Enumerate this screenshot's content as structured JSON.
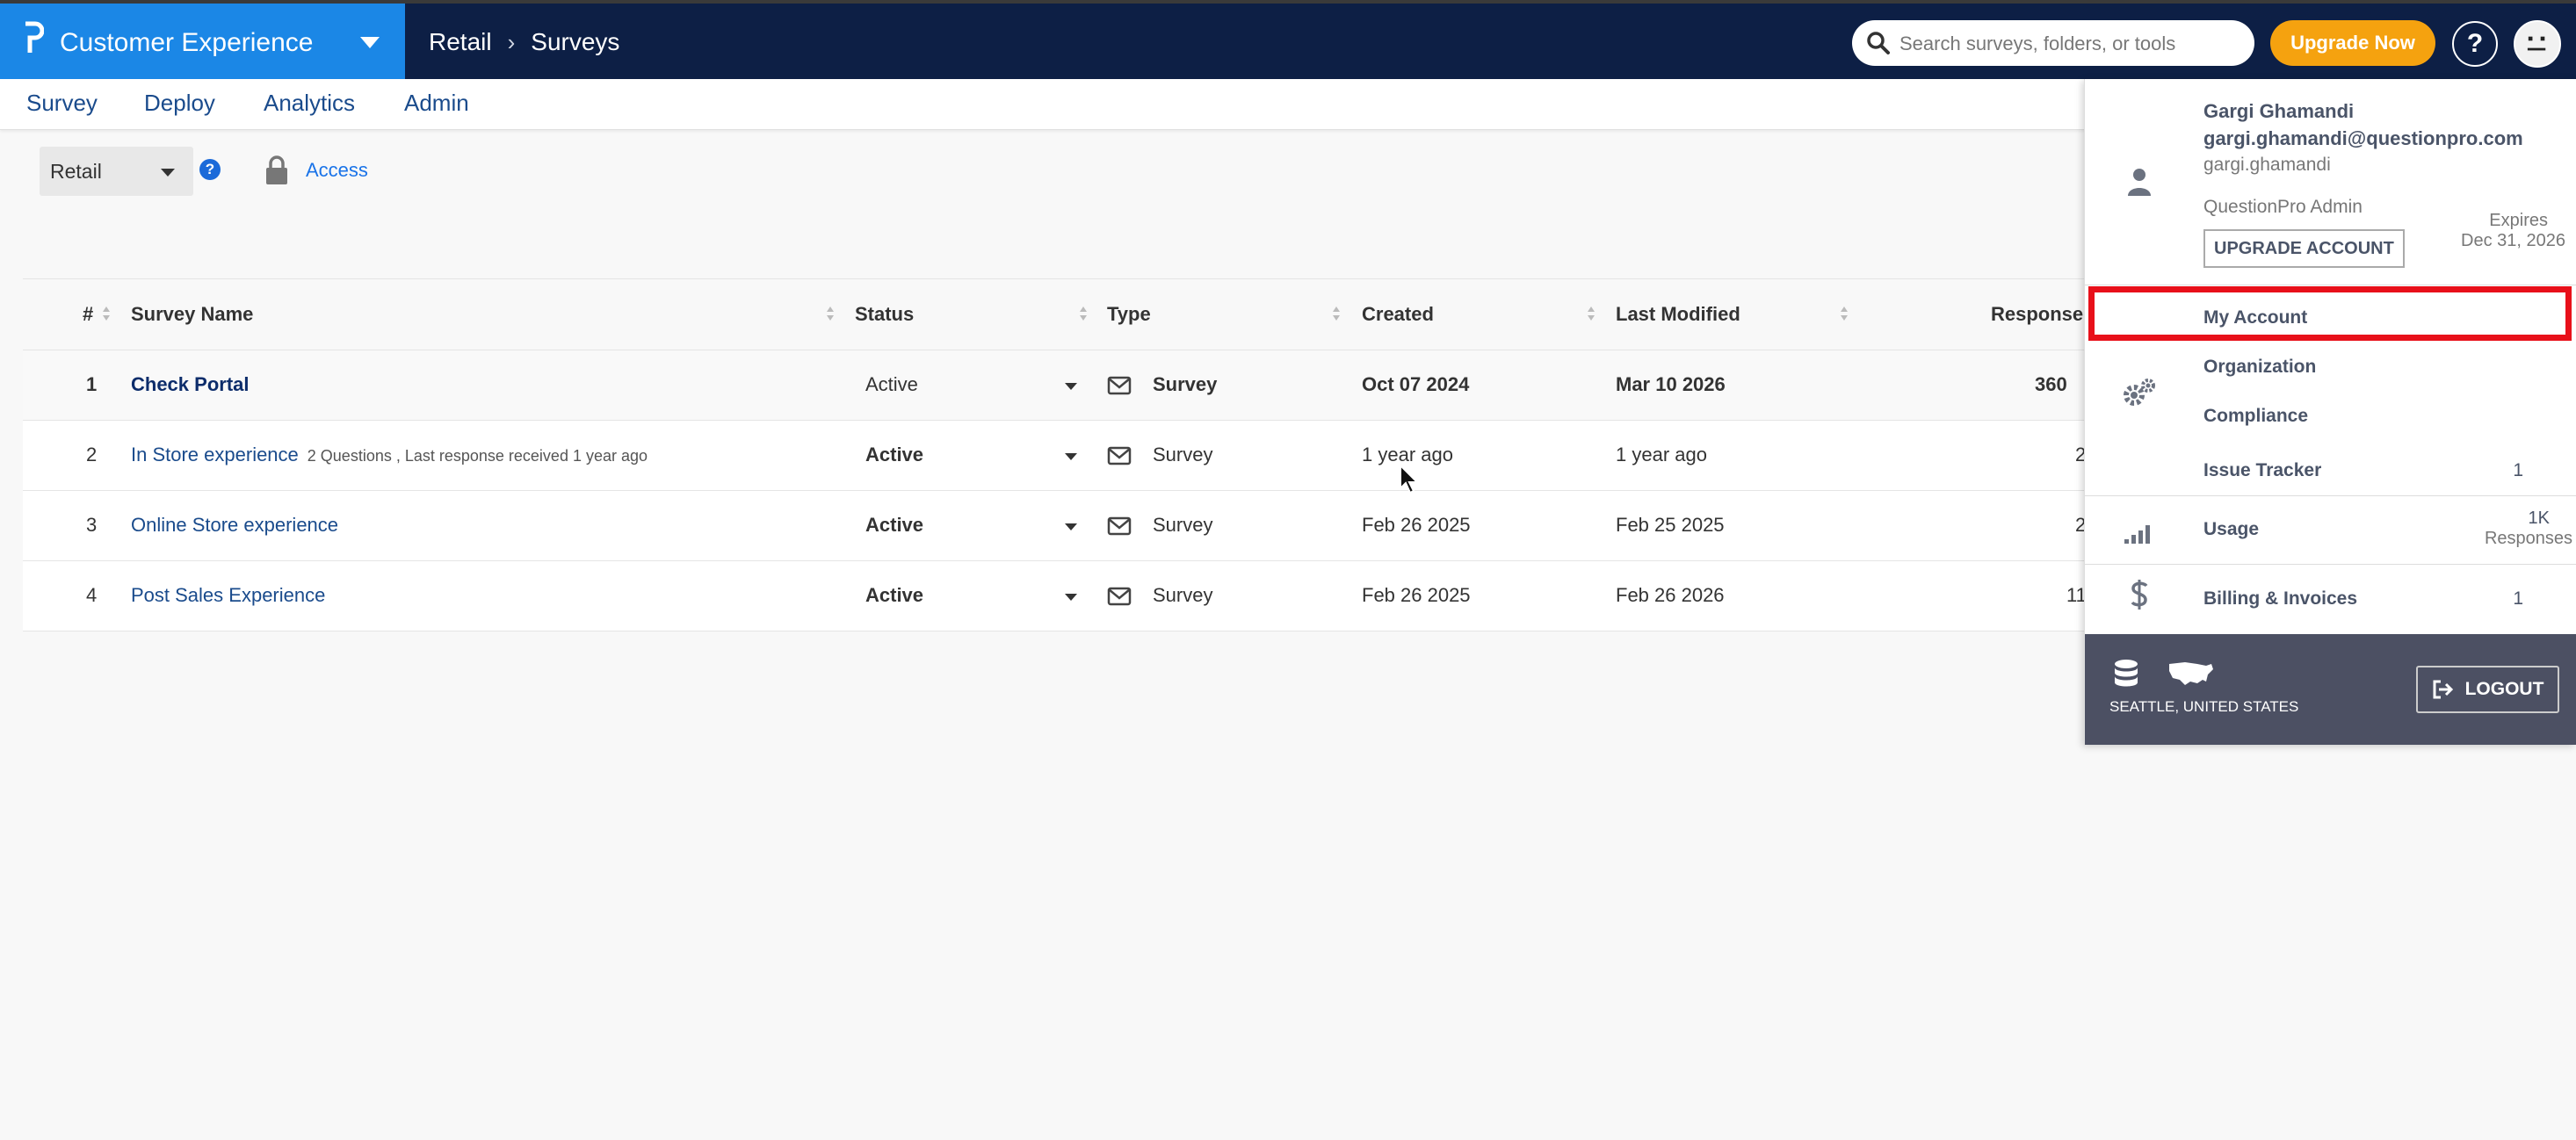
{
  "brand": {
    "name": "Customer Experience"
  },
  "breadcrumb": {
    "parent": "Retail",
    "separator": "›",
    "current": "Surveys"
  },
  "search": {
    "placeholder": "Search surveys, folders, or tools"
  },
  "header": {
    "upgrade_label": "Upgrade Now",
    "help_label": "?"
  },
  "nav": {
    "items": [
      "Survey",
      "Deploy",
      "Analytics",
      "Admin"
    ]
  },
  "filter": {
    "folder": "Retail",
    "access_label": "Access"
  },
  "table": {
    "headers": [
      "#",
      "Survey Name",
      "Status",
      "Type",
      "Created",
      "Last Modified",
      "Responses"
    ],
    "rows": [
      {
        "num": "1",
        "name": "Check Portal",
        "meta": "",
        "status": "Active",
        "type": "Survey",
        "created": "Oct 07 2024",
        "modified": "Mar 10 2026",
        "responses": "360"
      },
      {
        "num": "2",
        "name": "In Store experience",
        "meta": "2 Questions , Last response received 1 year ago",
        "status": "Active",
        "type": "Survey",
        "created": "1 year ago",
        "modified": "1 year ago",
        "responses": "2"
      },
      {
        "num": "3",
        "name": "Online Store experience",
        "meta": "",
        "status": "Active",
        "type": "Survey",
        "created": "Feb 26 2025",
        "modified": "Feb 25 2025",
        "responses": "2"
      },
      {
        "num": "4",
        "name": "Post Sales Experience",
        "meta": "",
        "status": "Active",
        "type": "Survey",
        "created": "Feb 26 2025",
        "modified": "Feb 26 2026",
        "responses": "11"
      }
    ]
  },
  "account_menu": {
    "user_name": "Gargi Ghamandi",
    "email": "gargi.ghamandi@questionpro.com",
    "username": "gargi.ghamandi",
    "role": "QuestionPro Admin",
    "upgrade_label": "UPGRADE ACCOUNT",
    "expires_label": "Expires",
    "expires_date": "Dec 31, 2026",
    "my_account": "My Account",
    "organization": "Organization",
    "compliance": "Compliance",
    "issue_tracker": "Issue Tracker",
    "issue_count": "1",
    "usage": "Usage",
    "usage_value": "1K",
    "usage_unit": "Responses",
    "billing": "Billing & Invoices",
    "billing_count": "1",
    "location": "SEATTLE, UNITED STATES",
    "logout_label": "LOGOUT",
    "highlight_color": "#e8101a"
  },
  "colors": {
    "topbar": "#0d1f45",
    "brand": "#1b87e6",
    "upgrade": "#f5a20f",
    "link": "#1a4b8c"
  }
}
